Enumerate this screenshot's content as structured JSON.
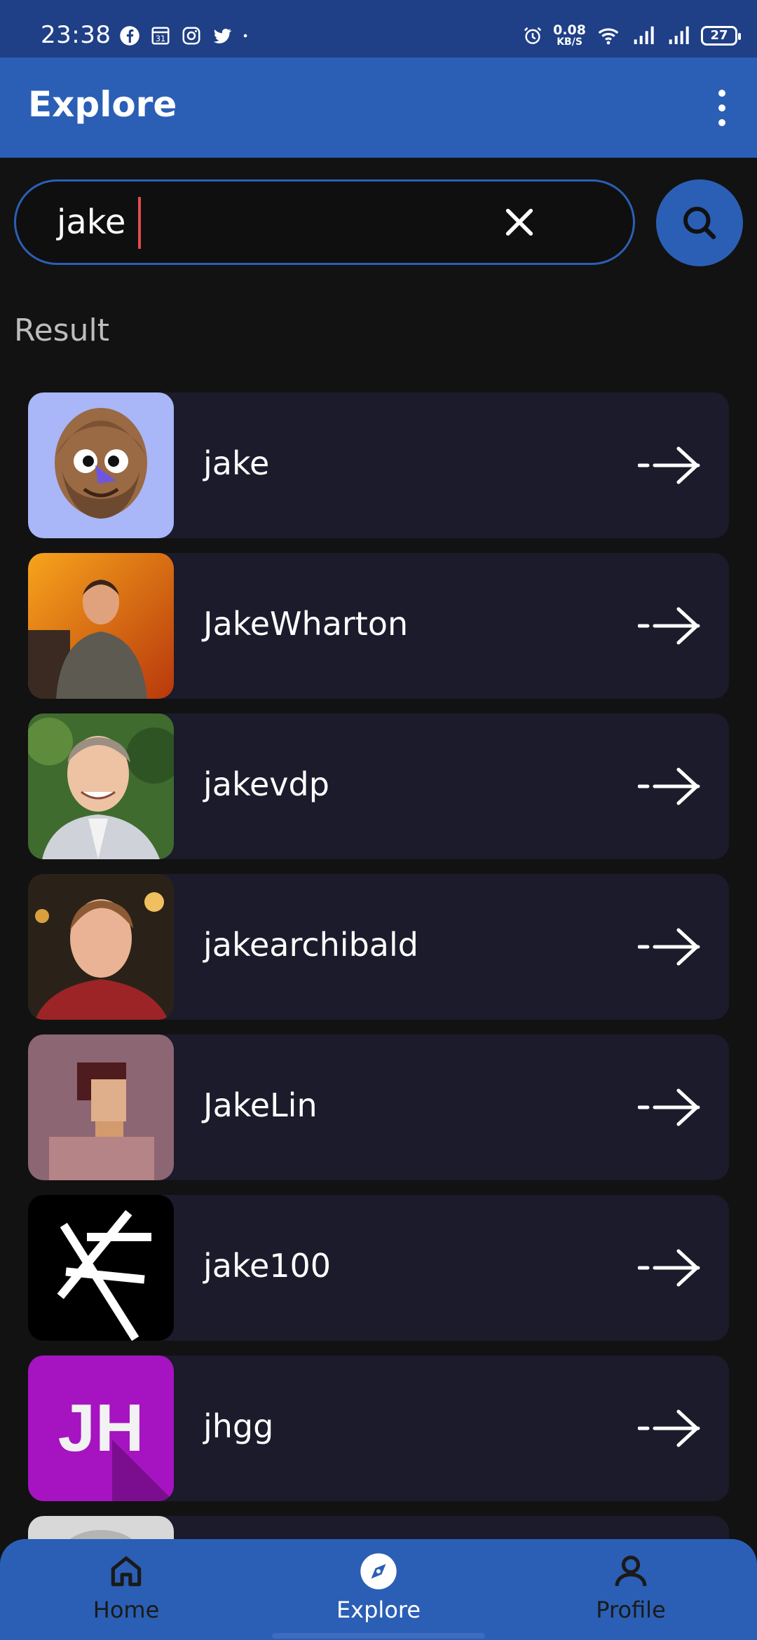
{
  "status_bar": {
    "time": "23:38",
    "net_speed_value": "0.08",
    "net_speed_unit": "KB/S",
    "battery": "27",
    "left_icons": [
      "facebook-icon",
      "calendar-icon",
      "instagram-icon",
      "twitter-icon",
      "dot-icon"
    ],
    "right_icons": [
      "alarm-icon",
      "wifi-icon",
      "signal-icon",
      "signal-icon"
    ]
  },
  "app_bar": {
    "title": "Explore"
  },
  "search": {
    "value": "jake"
  },
  "result_label": "Result",
  "results": [
    {
      "username": "jake"
    },
    {
      "username": "JakeWharton"
    },
    {
      "username": "jakevdp"
    },
    {
      "username": "jakearchibald"
    },
    {
      "username": "JakeLin"
    },
    {
      "username": "jake100"
    },
    {
      "username": "jhgg",
      "avatar_text": "JH"
    },
    {
      "username": ""
    }
  ],
  "nav": {
    "home": "Home",
    "explore": "Explore",
    "profile": "Profile",
    "active": "explore"
  },
  "colors": {
    "primary": "#2b5fb5",
    "status_bar": "#1f3f86",
    "background": "#121212",
    "card": "#1b1b2b",
    "caret": "#e34b4b"
  }
}
